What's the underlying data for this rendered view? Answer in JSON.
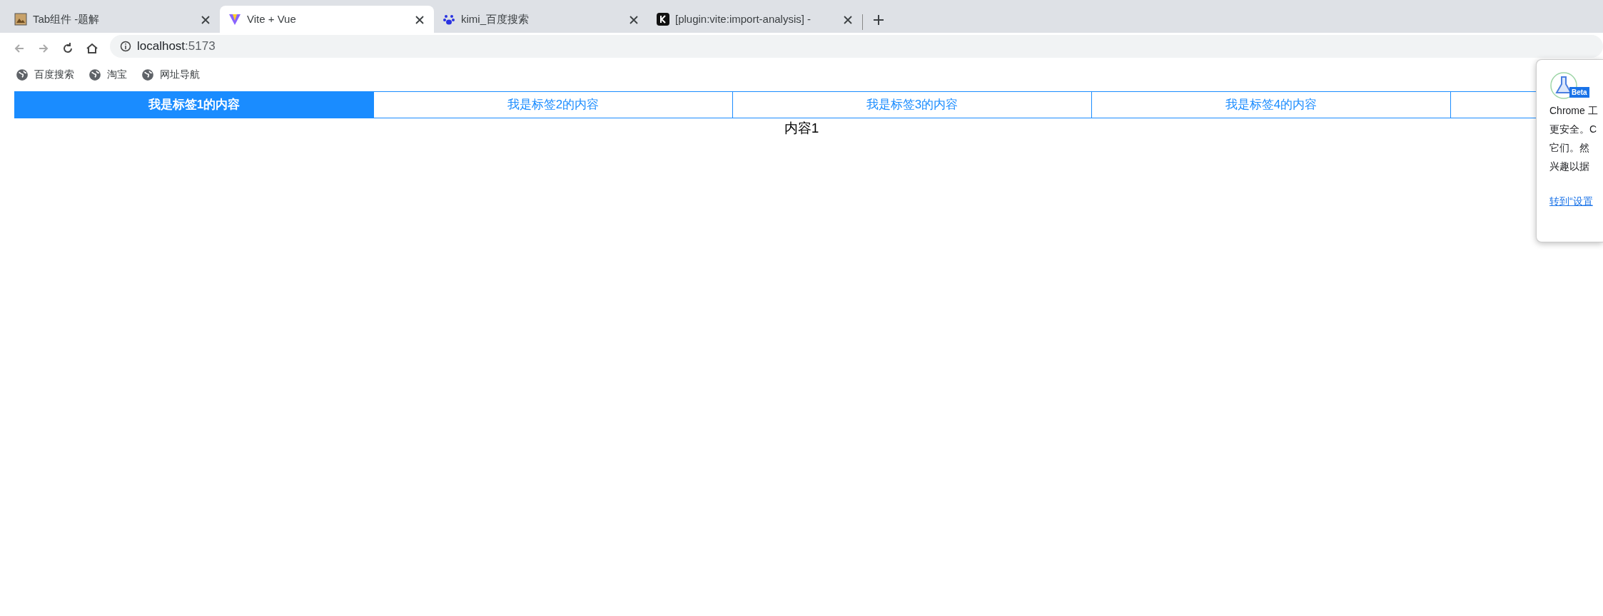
{
  "browser_tabs": [
    {
      "title": "Tab组件 -题解",
      "selected": false,
      "kind": "image"
    },
    {
      "title": "Vite + Vue",
      "selected": true,
      "kind": "vite"
    },
    {
      "title": "kimi_百度搜索",
      "selected": false,
      "kind": "paw"
    },
    {
      "title": "[plugin:vite:import-analysis] - ",
      "selected": false,
      "kind": "k"
    }
  ],
  "address_bar": {
    "host": "localhost",
    "port": ":5173"
  },
  "bookmarks": [
    {
      "label": "百度搜索"
    },
    {
      "label": "淘宝"
    },
    {
      "label": "网址导航"
    }
  ],
  "content_tabs": [
    {
      "label": "我是标签1的内容",
      "selected": true
    },
    {
      "label": "我是标签2的内容",
      "selected": false
    },
    {
      "label": "我是标签3的内容",
      "selected": false
    },
    {
      "label": "我是标签4的内容",
      "selected": false
    }
  ],
  "content_text": "内容1",
  "popup": {
    "badge": "Beta",
    "lines": [
      "Chrome 工",
      "更安全。C",
      "它们。然",
      "兴趣以据"
    ],
    "link": "转到“设置"
  }
}
